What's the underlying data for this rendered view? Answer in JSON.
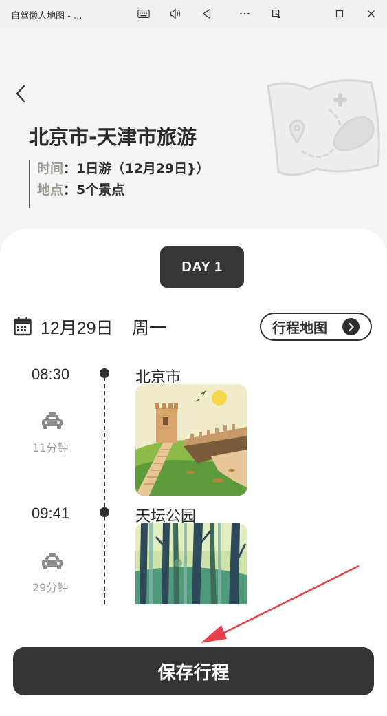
{
  "window": {
    "title": "自驾懒人地图 - ...",
    "icons": [
      "keyboard-icon",
      "volume-icon",
      "back-triangle-icon",
      "more-icon",
      "restore-window-icon",
      "maximize-icon",
      "close-icon"
    ]
  },
  "header": {
    "title": "北京市-天津市旅游",
    "time_label": "时间",
    "time_value": "1日游（12月29日}）",
    "place_label": "地点",
    "place_value": "5个景点",
    "colon": "："
  },
  "itinerary": {
    "day_label": "DAY 1",
    "date": "12月29日",
    "weekday": "周一",
    "map_button": "行程地图",
    "stops": [
      {
        "time": "08:30",
        "name": "北京市",
        "transport_duration": "11分钟",
        "image": "great-wall-illustration"
      },
      {
        "time": "09:41",
        "name": "天坛公园",
        "transport_duration": "29分钟",
        "image": "forest-illustration"
      }
    ]
  },
  "footer": {
    "save_button": "保存行程"
  },
  "colors": {
    "background": "#f4f4f4",
    "dark": "#343434",
    "muted_label": "#9a9a8f",
    "annotation_arrow": "#e8404a"
  }
}
